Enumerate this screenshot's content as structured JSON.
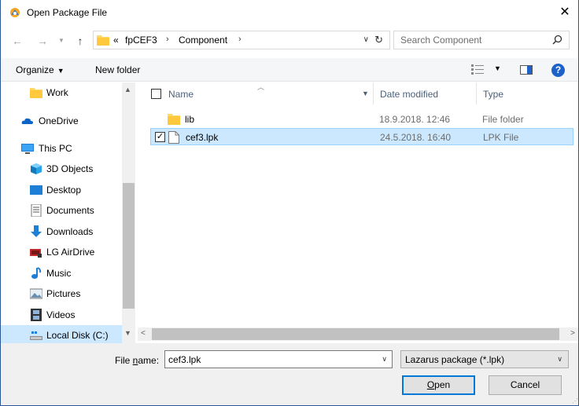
{
  "window": {
    "title": "Open Package File",
    "close_glyph": "✕"
  },
  "address": {
    "prefix": "«",
    "crumbs": [
      "fpCEF3",
      "Component"
    ],
    "search_placeholder": "Search Component"
  },
  "toolbar": {
    "organize": "Organize",
    "new_folder": "New folder"
  },
  "nav": {
    "items": [
      {
        "label": "Work",
        "icon": "folder-icon"
      },
      {
        "label": "OneDrive",
        "icon": "onedrive-icon"
      },
      {
        "label": "This PC",
        "icon": "pc-icon"
      },
      {
        "label": "3D Objects",
        "icon": "3d-objects-icon"
      },
      {
        "label": "Desktop",
        "icon": "desktop-icon"
      },
      {
        "label": "Documents",
        "icon": "documents-icon"
      },
      {
        "label": "Downloads",
        "icon": "downloads-icon"
      },
      {
        "label": "LG AirDrive",
        "icon": "airdrive-icon"
      },
      {
        "label": "Music",
        "icon": "music-icon"
      },
      {
        "label": "Pictures",
        "icon": "pictures-icon"
      },
      {
        "label": "Videos",
        "icon": "videos-icon"
      },
      {
        "label": "Local Disk (C:)",
        "icon": "disk-icon"
      }
    ]
  },
  "columns": {
    "name": "Name",
    "date": "Date modified",
    "type": "Type"
  },
  "files": [
    {
      "name": "lib",
      "date": "18.9.2018. 12:46",
      "type": "File folder",
      "checked": false
    },
    {
      "name": "cef3.lpk",
      "date": "24.5.2018. 16:40",
      "type": "LPK File",
      "checked": true
    }
  ],
  "bottom": {
    "file_name_label_pre": "File ",
    "file_name_label_u": "n",
    "file_name_label_post": "ame:",
    "file_name_value": "cef3.lpk",
    "filter": "Lazarus package (*.lpk)",
    "open_label": "Open",
    "cancel_label": "Cancel"
  },
  "colors": {
    "accent": "#0078d7",
    "selection": "#cce8ff",
    "folder": "#ffd766",
    "help": "#1e62c9"
  }
}
